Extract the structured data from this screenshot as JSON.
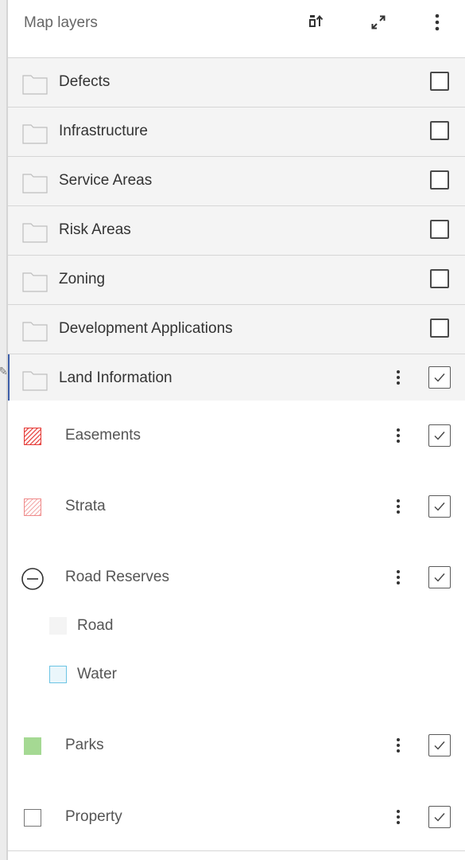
{
  "header": {
    "title": "Map layers",
    "icons": [
      "sort-icon",
      "expand-icon",
      "more-vertical-icon"
    ]
  },
  "groups": [
    {
      "label": "Defects",
      "checked": false
    },
    {
      "label": "Infrastructure",
      "checked": false
    },
    {
      "label": "Service Areas",
      "checked": false
    },
    {
      "label": "Risk Areas",
      "checked": false
    },
    {
      "label": "Zoning",
      "checked": false
    },
    {
      "label": "Development Applications",
      "checked": false
    },
    {
      "label": "Land Information",
      "checked": true,
      "expanded": true
    }
  ],
  "layers": [
    {
      "label": "Easements",
      "symbol": "hatch",
      "color": "#e53935",
      "checked": true
    },
    {
      "label": "Strata",
      "symbol": "hatch",
      "color": "#ef8a8a",
      "checked": true
    },
    {
      "label": "Road Reserves",
      "symbol": "collapse-circle",
      "checked": true,
      "legend": [
        {
          "label": "Road",
          "fill": "#f4f4f4",
          "border": "#f4f4f4"
        },
        {
          "label": "Water",
          "fill": "#eaf6fb",
          "border": "#6cc4e4"
        }
      ]
    },
    {
      "label": "Parks",
      "symbol": "fill",
      "color": "#a5d993",
      "checked": true
    },
    {
      "label": "Property",
      "symbol": "outline",
      "color": "#777777",
      "checked": true
    }
  ],
  "colors": {
    "accent": "#3d5ea8",
    "group_background": "#f4f4f4",
    "divider": "#d6d6d6"
  }
}
